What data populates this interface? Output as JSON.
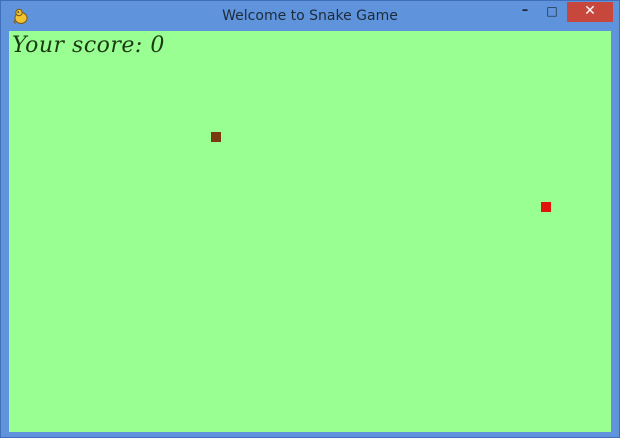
{
  "window": {
    "title": "Welcome to Snake Game",
    "icon": "pygame-snake-icon",
    "controls": {
      "minimize_glyph": "–",
      "maximize_glyph": "□",
      "close_glyph": "✕"
    }
  },
  "game": {
    "score_text": "Your score: 0",
    "score": 0,
    "colors": {
      "background": "#99ff93",
      "snake": "#7a3a10",
      "food": "#e0140a",
      "score_text": "#1b3a12"
    }
  }
}
